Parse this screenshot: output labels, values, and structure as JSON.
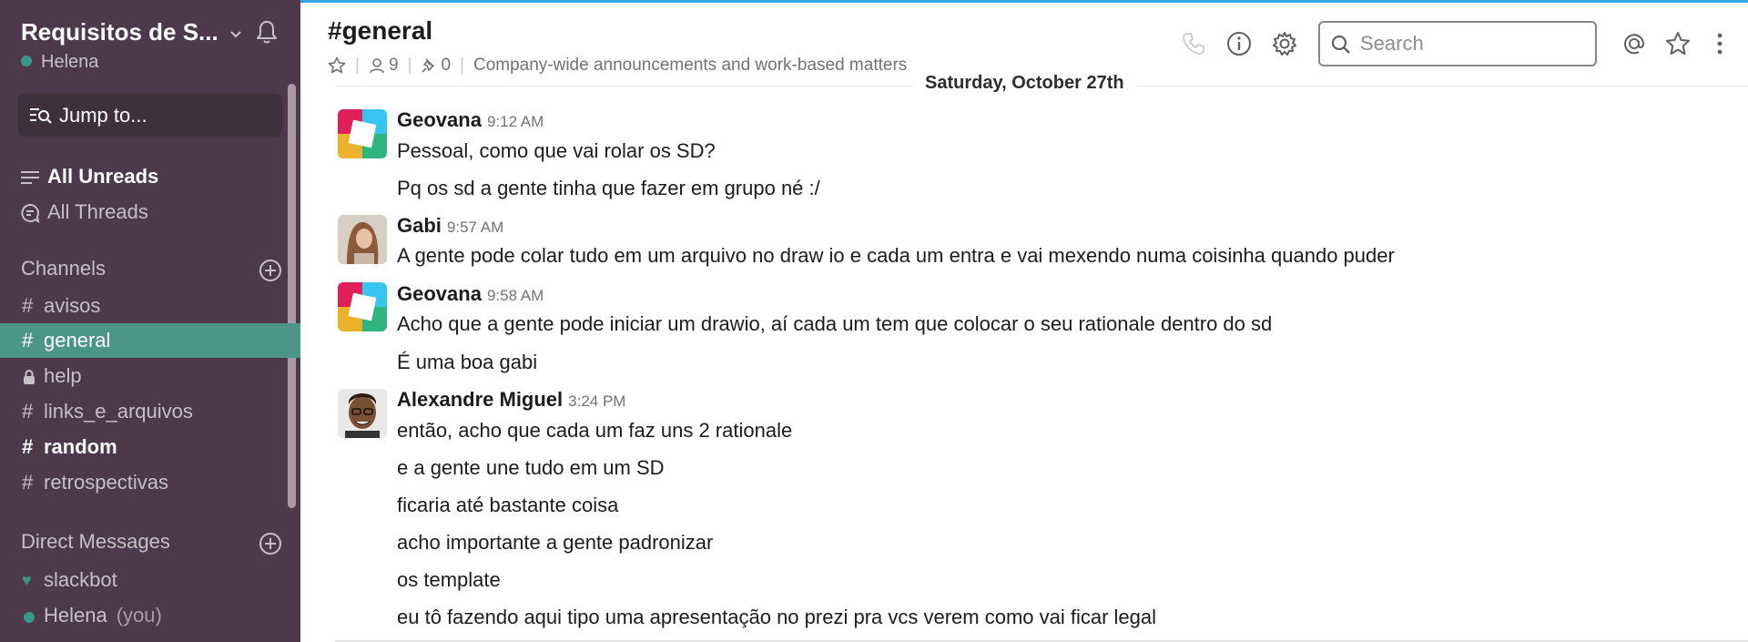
{
  "team": {
    "name": "Requisitos de S...",
    "user": "Helena"
  },
  "sidebar": {
    "jump_to": "Jump to...",
    "nav": [
      {
        "label": "All Unreads"
      },
      {
        "label": "All Threads"
      }
    ],
    "channels_heading": "Channels",
    "channels": [
      {
        "prefix": "#",
        "label": "avisos"
      },
      {
        "prefix": "#",
        "label": "general"
      },
      {
        "prefix": "",
        "label": "help"
      },
      {
        "prefix": "#",
        "label": "links_e_arquivos"
      },
      {
        "prefix": "#",
        "label": "random"
      },
      {
        "prefix": "#",
        "label": "retrospectivas"
      }
    ],
    "dm_heading": "Direct Messages",
    "dms": [
      {
        "label": "slackbot"
      },
      {
        "label": "Helena",
        "suffix": "(you)"
      }
    ]
  },
  "header": {
    "title": "#general",
    "members": "9",
    "pins": "0",
    "topic": "Company-wide announcements and work-based matters",
    "search_placeholder": "Search"
  },
  "messages": {
    "day": "Saturday, October 27th",
    "groups": [
      {
        "author": "Geovana",
        "time": "9:12 AM",
        "avatar": "slack-logo-avatar",
        "lines": [
          "Pessoal, como que vai rolar os SD?",
          "Pq os sd a gente tinha que fazer em grupo né :/"
        ]
      },
      {
        "author": "Gabi",
        "time": "9:57 AM",
        "avatar": "photo-avatar",
        "lines": [
          "A gente pode colar tudo em um arquivo no draw io e cada um entra e vai mexendo numa coisinha quando puder"
        ]
      },
      {
        "author": "Geovana",
        "time": "9:58 AM",
        "avatar": "slack-logo-avatar",
        "lines": [
          "Acho que a gente pode iniciar um drawio, aí cada um tem que colocar o seu rationale dentro do sd",
          "É uma boa gabi"
        ]
      },
      {
        "author": "Alexandre Miguel",
        "time": "3:24 PM",
        "avatar": "photo-avatar",
        "lines": [
          "então, acho que cada um faz uns 2 rationale",
          "e a gente une tudo em um SD",
          "ficaria até bastante coisa",
          "acho importante a gente padronizar",
          "os template",
          "eu tô fazendo aqui tipo uma apresentação no prezi pra vcs verem como vai ficar legal"
        ]
      }
    ]
  },
  "colors": {
    "sidebar": "#4d394b",
    "active_channel": "#4c9689",
    "presence": "#38978d",
    "top_accent": "#3aa3e3"
  }
}
